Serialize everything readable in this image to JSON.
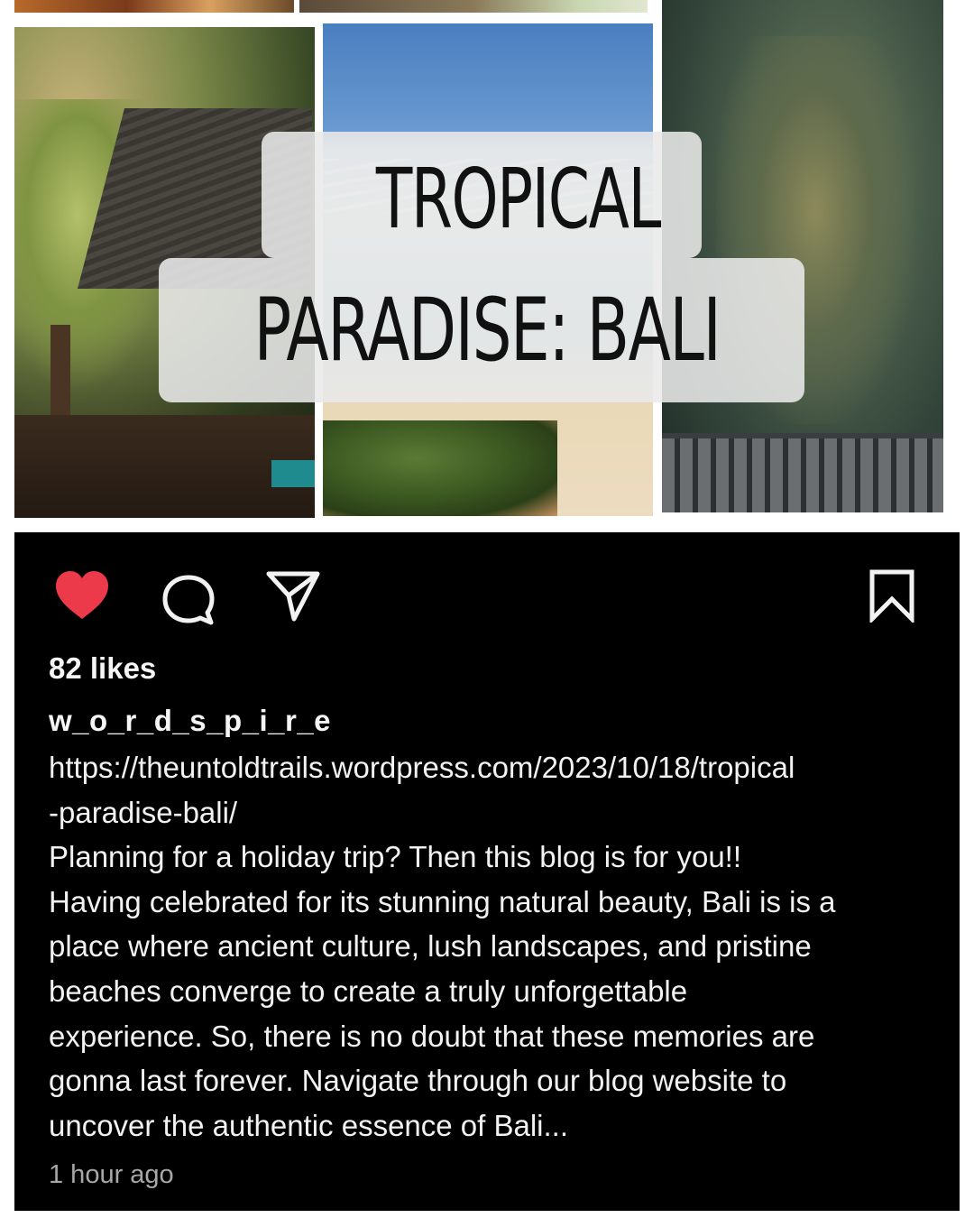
{
  "image": {
    "title_lines": [
      "TROPICAL",
      "PARADISE: BALI"
    ]
  },
  "post": {
    "likes": "82 likes",
    "username": "w_o_r_d_s_p_i_r_e",
    "caption_lines": [
      "https://theuntoldtrails.wordpress.com/2023/10/18/tropical",
      "-paradise-bali/",
      "Planning for a holiday trip? Then this blog is for you!!",
      "Having celebrated for its stunning natural beauty, Bali is is a",
      "place where ancient culture, lush landscapes, and pristine",
      "beaches converge to create a truly unforgettable",
      "experience. So, there is no doubt that these memories are",
      "gonna last forever. Navigate through our blog website to",
      "uncover the authentic essence of Bali..."
    ],
    "timestamp": "1 hour ago"
  },
  "icons": {
    "like": "heart-icon",
    "comment": "comment-icon",
    "share": "share-icon",
    "save": "bookmark-icon"
  },
  "colors": {
    "like_active": "#ed3a4a",
    "post_background": "#000000",
    "timestamp": "#a8a8a8"
  }
}
